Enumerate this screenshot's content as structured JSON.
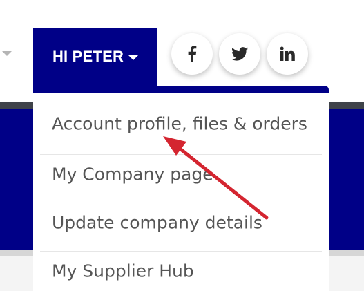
{
  "header": {
    "user_greeting": "HI PETER"
  },
  "social": [
    {
      "name": "facebook-icon",
      "glyph": "f"
    },
    {
      "name": "twitter-icon",
      "glyph": "twitter"
    },
    {
      "name": "linkedin-icon",
      "glyph": "in"
    }
  ],
  "dropdown": {
    "items": [
      {
        "label": "Account profile, files & orders"
      },
      {
        "label": "My Company page"
      },
      {
        "label": "Update company details"
      },
      {
        "label": "My Supplier Hub"
      }
    ]
  },
  "colors": {
    "brand_blue": "#000087",
    "annotation_arrow": "#d42530",
    "menu_text": "#555555"
  }
}
